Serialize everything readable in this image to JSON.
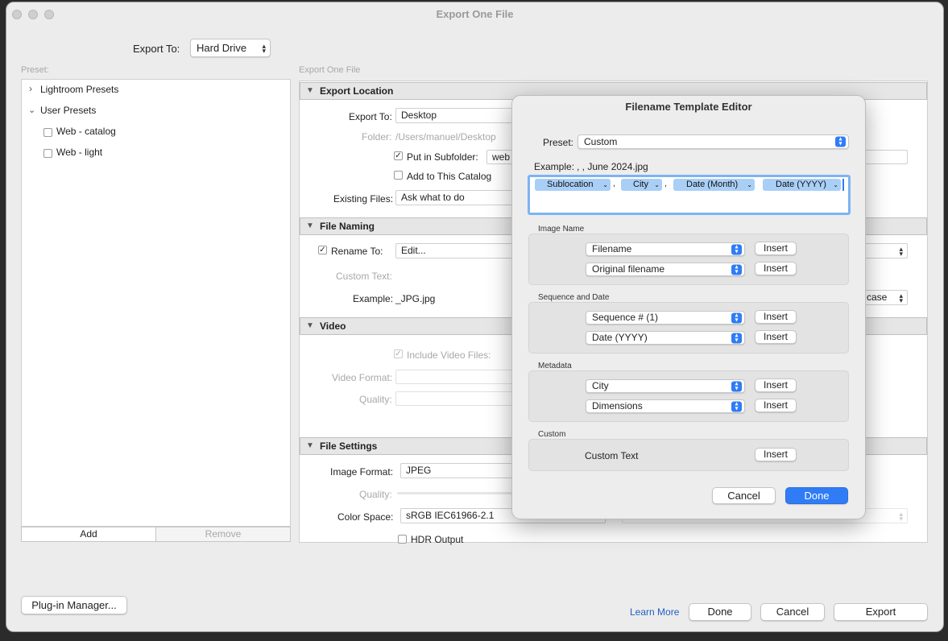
{
  "window": {
    "title": "Export One File"
  },
  "header": {
    "export_to_label": "Export To:",
    "export_to_value": "Hard Drive"
  },
  "sidebar": {
    "preset_label": "Preset:",
    "groups": [
      {
        "label": "Lightroom Presets",
        "chevron": "›"
      },
      {
        "label": "User Presets",
        "chevron": "⌄"
      }
    ],
    "items": [
      {
        "label": "Web - catalog"
      },
      {
        "label": "Web - light"
      }
    ],
    "add_label": "Add",
    "remove_label": "Remove"
  },
  "main": {
    "breadcrumb": "Export One File",
    "export_location": {
      "title": "Export Location",
      "export_to_label": "Export To:",
      "export_to_value": "Desktop",
      "folder_label": "Folder:",
      "folder_value": "/Users/manuel/Desktop",
      "subfolder_label": "Put in Subfolder:",
      "subfolder_value": "web -",
      "add_catalog_label": "Add to This Catalog",
      "existing_label": "Existing Files:",
      "existing_value": "Ask what to do"
    },
    "file_naming": {
      "title": "File Naming",
      "rename_label": "Rename To:",
      "rename_value": "Edit...",
      "custom_text_label": "Custom Text:",
      "example_label": "Example:",
      "example_value": "_JPG.jpg",
      "case_value": "case"
    },
    "video": {
      "title": "Video",
      "include_label": "Include Video Files:",
      "format_label": "Video Format:",
      "quality_label": "Quality:"
    },
    "file_settings": {
      "title": "File Settings",
      "image_format_label": "Image Format:",
      "image_format_value": "JPEG",
      "quality_label": "Quality:",
      "color_space_label": "Color Space:",
      "color_space_value": "sRGB IEC61966-2.1",
      "hdr_label": "HDR Output"
    }
  },
  "footer": {
    "plugin_manager": "Plug-in Manager...",
    "learn_more": "Learn More",
    "done": "Done",
    "cancel": "Cancel",
    "export": "Export"
  },
  "dialog": {
    "title": "Filename Template Editor",
    "preset_label": "Preset:",
    "preset_value": "Custom",
    "example_label": "Example:",
    "example_value": ", , June 2024.jpg",
    "tokens": [
      {
        "label": "Sublocation"
      },
      {
        "label": "City"
      },
      {
        "label": "Date (Month)"
      },
      {
        "label": "Date (YYYY)"
      }
    ],
    "separator": ",",
    "groups": {
      "image_name": {
        "label": "Image Name",
        "select1": "Filename",
        "select2": "Original filename"
      },
      "sequence_date": {
        "label": "Sequence and Date",
        "select1": "Sequence # (1)",
        "select2": "Date (YYYY)"
      },
      "metadata": {
        "label": "Metadata",
        "select1": "City",
        "select2": "Dimensions"
      },
      "custom": {
        "label": "Custom",
        "text": "Custom Text"
      }
    },
    "insert_label": "Insert",
    "cancel": "Cancel",
    "done": "Done"
  },
  "colors": {
    "accent": "#2f7cf6",
    "token_bg": "#a9cff7",
    "link": "#1f5fc4"
  }
}
